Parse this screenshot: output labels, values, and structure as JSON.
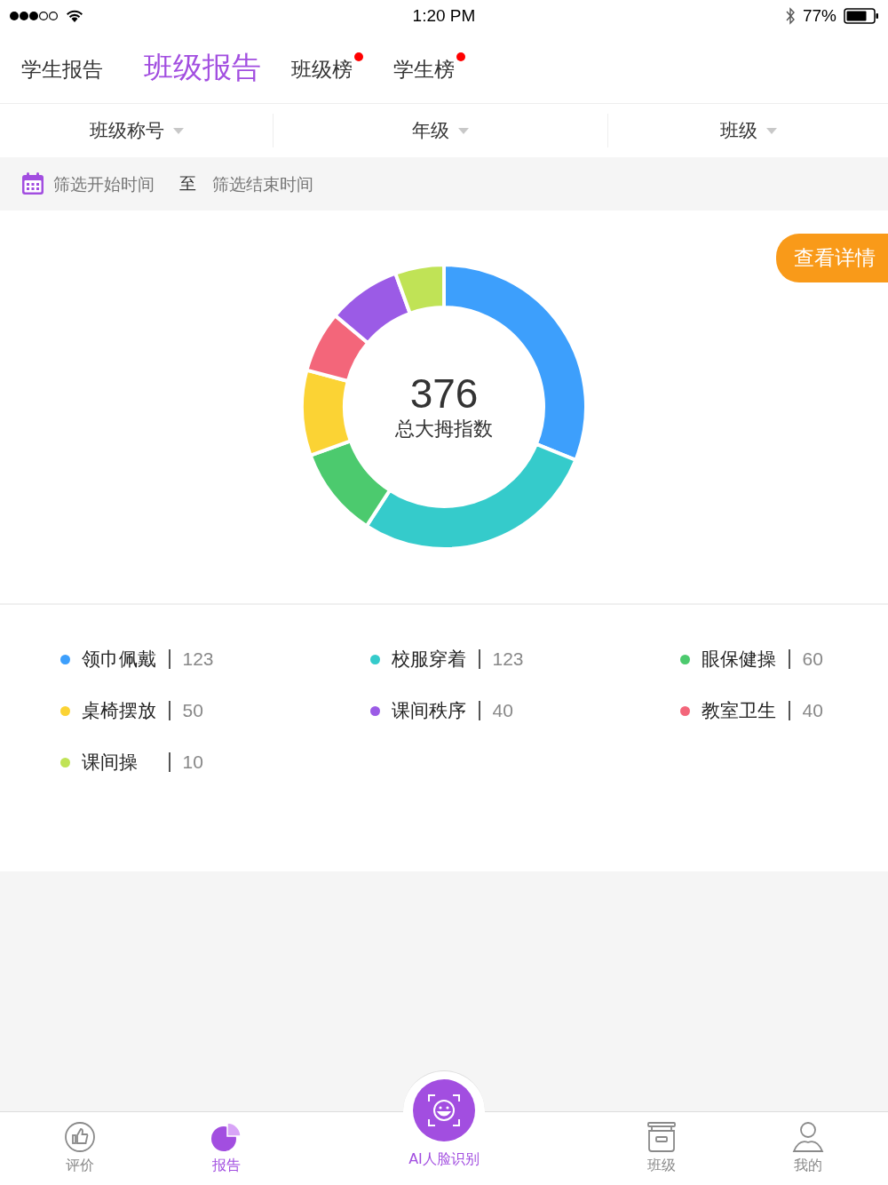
{
  "status_bar": {
    "time": "1:20 PM",
    "battery": "77%"
  },
  "tabs": [
    {
      "label": "学生报告",
      "selected": false,
      "dot": false
    },
    {
      "label": "班级报告",
      "selected": true,
      "dot": false
    },
    {
      "label": "班级榜",
      "selected": false,
      "dot": true
    },
    {
      "label": "学生榜",
      "selected": false,
      "dot": true
    }
  ],
  "filters": [
    "班级称号",
    "年级",
    "班级"
  ],
  "date_range": {
    "start_placeholder": "筛选开始时间",
    "separator": "至",
    "end_placeholder": "筛选结束时间"
  },
  "details_button": "查看详情",
  "chart": {
    "total": "376",
    "total_label": "总大拇指数"
  },
  "legend": [
    {
      "name": "领巾佩戴",
      "value": "123",
      "color": "#3d9ffc"
    },
    {
      "name": "校服穿着",
      "value": "123",
      "color": "#35cbcb"
    },
    {
      "name": "眼保健操",
      "value": "60",
      "color": "#4cca6e"
    },
    {
      "name": "桌椅摆放",
      "value": "50",
      "color": "#fbd334"
    },
    {
      "name": "课间秩序",
      "value": "40",
      "color": "#9b5be6"
    },
    {
      "name": "教室卫生",
      "value": "40",
      "color": "#f3667a"
    },
    {
      "name": "课间操",
      "value": "10",
      "color": "#c0e356"
    }
  ],
  "bottom_nav": [
    {
      "label": "评价",
      "kind": "tab",
      "selected": false
    },
    {
      "label": "报告",
      "kind": "tab",
      "selected": true
    },
    {
      "label": "AI人脸识别",
      "kind": "center"
    },
    {
      "label": "班级",
      "kind": "tab",
      "selected": false
    },
    {
      "label": "我的",
      "kind": "tab",
      "selected": false
    }
  ]
}
